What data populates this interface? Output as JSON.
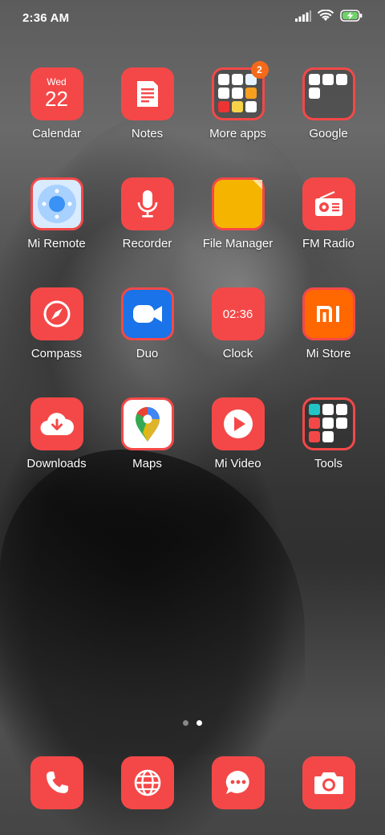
{
  "status_bar": {
    "time": "2:36 AM",
    "icons": [
      "signal-icon",
      "wifi-icon",
      "battery-charging-icon"
    ]
  },
  "apps": [
    {
      "id": "calendar",
      "label": "Calendar",
      "day": "Wed",
      "date": "22"
    },
    {
      "id": "notes",
      "label": "Notes"
    },
    {
      "id": "more-apps",
      "label": "More apps",
      "badge": "2"
    },
    {
      "id": "google",
      "label": "Google"
    },
    {
      "id": "mi-remote",
      "label": "Mi Remote"
    },
    {
      "id": "recorder",
      "label": "Recorder"
    },
    {
      "id": "file-manager",
      "label": "File Manager"
    },
    {
      "id": "fm-radio",
      "label": "FM Radio"
    },
    {
      "id": "compass",
      "label": "Compass"
    },
    {
      "id": "duo",
      "label": "Duo"
    },
    {
      "id": "clock",
      "label": "Clock",
      "time": "02:36"
    },
    {
      "id": "mi-store",
      "label": "Mi Store"
    },
    {
      "id": "downloads",
      "label": "Downloads"
    },
    {
      "id": "maps",
      "label": "Maps"
    },
    {
      "id": "mi-video",
      "label": "Mi Video"
    },
    {
      "id": "tools",
      "label": "Tools"
    }
  ],
  "pages": {
    "count": 2,
    "current": 2
  },
  "dock": [
    "phone-icon",
    "browser-icon",
    "messages-icon",
    "camera-icon"
  ],
  "colors": {
    "accent": "#f44848",
    "badge": "#f46a1a",
    "duo_blue": "#1a73e8",
    "file_yellow": "#f5b400",
    "mi_orange": "#ff6700"
  }
}
